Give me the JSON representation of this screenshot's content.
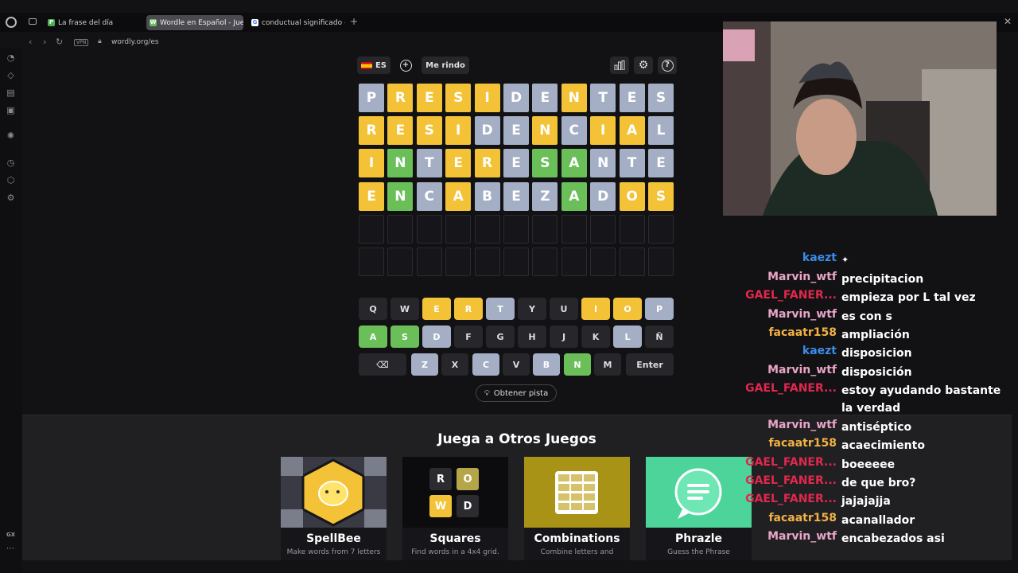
{
  "browser": {
    "tabs": [
      {
        "label": "La frase del día",
        "fav_color": "#4caf50",
        "fav_letter": "P"
      },
      {
        "label": "Wordle en Español - Jueg",
        "fav_color": "#6bbf59",
        "fav_letter": "W"
      },
      {
        "label": "conductual significado - B",
        "fav_color": "#ffffff",
        "fav_letter": "G"
      }
    ],
    "url": "wordly.org/es",
    "vpn_label": "VPN",
    "sidebar_gx": "GX"
  },
  "toolbar": {
    "lang": "ES",
    "give_up": "Me rindo"
  },
  "board": {
    "rows": [
      {
        "letters": [
          "P",
          "R",
          "E",
          "S",
          "I",
          "D",
          "E",
          "N",
          "T",
          "E",
          "S"
        ],
        "states": [
          "x",
          "y",
          "y",
          "y",
          "y",
          "x",
          "x",
          "y",
          "x",
          "x",
          "x"
        ]
      },
      {
        "letters": [
          "R",
          "E",
          "S",
          "I",
          "D",
          "E",
          "N",
          "C",
          "I",
          "A",
          "L"
        ],
        "states": [
          "y",
          "y",
          "y",
          "y",
          "x",
          "x",
          "y",
          "x",
          "y",
          "y",
          "x"
        ]
      },
      {
        "letters": [
          "I",
          "N",
          "T",
          "E",
          "R",
          "E",
          "S",
          "A",
          "N",
          "T",
          "E"
        ],
        "states": [
          "y",
          "g",
          "x",
          "y",
          "y",
          "x",
          "g",
          "g",
          "x",
          "x",
          "x"
        ]
      },
      {
        "letters": [
          "E",
          "N",
          "C",
          "A",
          "B",
          "E",
          "Z",
          "A",
          "D",
          "O",
          "S"
        ],
        "states": [
          "y",
          "g",
          "x",
          "y",
          "x",
          "x",
          "x",
          "g",
          "x",
          "y",
          "y"
        ]
      },
      {
        "letters": [
          "",
          "",
          "",
          "",
          "",
          "",
          "",
          "",
          "",
          "",
          ""
        ],
        "states": [
          "e",
          "e",
          "e",
          "e",
          "e",
          "e",
          "e",
          "e",
          "e",
          "e",
          "e"
        ]
      },
      {
        "letters": [
          "",
          "",
          "",
          "",
          "",
          "",
          "",
          "",
          "",
          "",
          ""
        ],
        "states": [
          "e",
          "e",
          "e",
          "e",
          "e",
          "e",
          "e",
          "e",
          "e",
          "e",
          "e"
        ]
      }
    ]
  },
  "keyboard": {
    "row1": [
      {
        "k": "Q",
        "s": ""
      },
      {
        "k": "W",
        "s": ""
      },
      {
        "k": "E",
        "s": "y"
      },
      {
        "k": "R",
        "s": "y"
      },
      {
        "k": "T",
        "s": "x"
      },
      {
        "k": "Y",
        "s": ""
      },
      {
        "k": "U",
        "s": ""
      },
      {
        "k": "I",
        "s": "y"
      },
      {
        "k": "O",
        "s": "y"
      },
      {
        "k": "P",
        "s": "x"
      }
    ],
    "row2": [
      {
        "k": "A",
        "s": "g"
      },
      {
        "k": "S",
        "s": "g"
      },
      {
        "k": "D",
        "s": "x"
      },
      {
        "k": "F",
        "s": ""
      },
      {
        "k": "G",
        "s": ""
      },
      {
        "k": "H",
        "s": ""
      },
      {
        "k": "J",
        "s": ""
      },
      {
        "k": "K",
        "s": ""
      },
      {
        "k": "L",
        "s": "x"
      },
      {
        "k": "Ñ",
        "s": ""
      }
    ],
    "row3": [
      {
        "k": "⌫",
        "s": ""
      },
      {
        "k": "Z",
        "s": "x"
      },
      {
        "k": "X",
        "s": ""
      },
      {
        "k": "C",
        "s": "x"
      },
      {
        "k": "V",
        "s": ""
      },
      {
        "k": "B",
        "s": "x"
      },
      {
        "k": "N",
        "s": "g"
      },
      {
        "k": "M",
        "s": ""
      },
      {
        "k": "Enter",
        "s": ""
      }
    ]
  },
  "hint_button": "Obtener pista",
  "games": {
    "title": "Juega a Otros Juegos",
    "cards": [
      {
        "name": "SpellBee",
        "desc": "Make words from 7 letters"
      },
      {
        "name": "Squares",
        "desc": "Find words in a 4x4 grid."
      },
      {
        "name": "Combinations",
        "desc": "Combine letters and"
      },
      {
        "name": "Phrazle",
        "desc": "Guess the Phrase"
      }
    ],
    "squares_letters": [
      "R",
      "O",
      "W",
      "D"
    ]
  },
  "chat": [
    {
      "user": "kaezt",
      "color": "#3b8ce8",
      "text": "",
      "badge": "✦"
    },
    {
      "user": "Marvin_wtf",
      "color": "#e9a5c8",
      "text": "precipitacion"
    },
    {
      "user": "GAEL_FANER...",
      "color": "#e0284e",
      "text": "empieza por L tal vez"
    },
    {
      "user": "Marvin_wtf",
      "color": "#e9a5c8",
      "text": "es con s"
    },
    {
      "user": "facaatr158",
      "color": "#f2b144",
      "text": "ampliación"
    },
    {
      "user": "kaezt",
      "color": "#3b8ce8",
      "text": "disposicion"
    },
    {
      "user": "Marvin_wtf",
      "color": "#e9a5c8",
      "text": "disposición"
    },
    {
      "user": "GAEL_FANER...",
      "color": "#e0284e",
      "text": "estoy ayudando bastante la verdad"
    },
    {
      "user": "Marvin_wtf",
      "color": "#e9a5c8",
      "text": "antiséptico"
    },
    {
      "user": "facaatr158",
      "color": "#f2b144",
      "text": "acaecimiento"
    },
    {
      "user": "GAEL_FANER...",
      "color": "#e0284e",
      "text": "boeeeee"
    },
    {
      "user": "GAEL_FANER...",
      "color": "#e0284e",
      "text": "de que bro?"
    },
    {
      "user": "GAEL_FANER...",
      "color": "#e0284e",
      "text": "jajajajja"
    },
    {
      "user": "facaatr158",
      "color": "#f2b144",
      "text": "acanallador"
    },
    {
      "user": "Marvin_wtf",
      "color": "#e9a5c8",
      "text": "encabezados asi"
    }
  ],
  "colors": {
    "green": "#6bbf59",
    "yellow": "#f3c237",
    "gray": "#a4aec4"
  }
}
